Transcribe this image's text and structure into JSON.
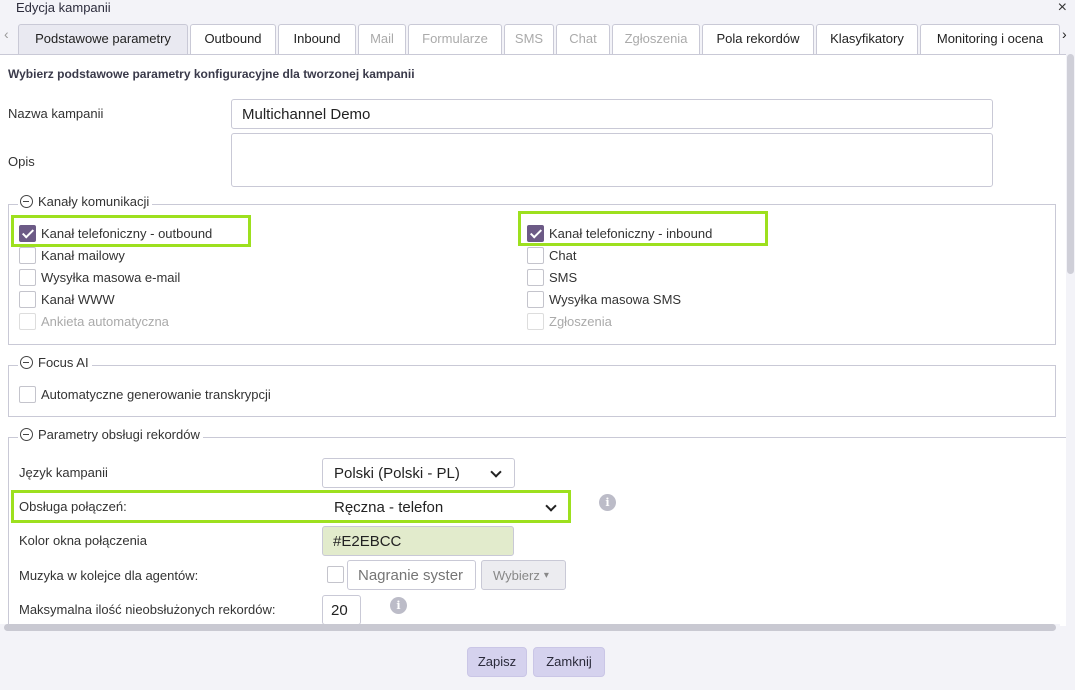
{
  "window": {
    "title": "Edycja kampanii",
    "close_symbol": "×"
  },
  "tabs": [
    {
      "label": "Podstawowe parametry",
      "active": true,
      "disabled": false
    },
    {
      "label": "Outbound",
      "active": false,
      "disabled": false
    },
    {
      "label": "Inbound",
      "active": false,
      "disabled": false
    },
    {
      "label": "Mail",
      "active": false,
      "disabled": true
    },
    {
      "label": "Formularze",
      "active": false,
      "disabled": true
    },
    {
      "label": "SMS",
      "active": false,
      "disabled": true
    },
    {
      "label": "Chat",
      "active": false,
      "disabled": true
    },
    {
      "label": "Zgłoszenia",
      "active": false,
      "disabled": true
    },
    {
      "label": "Pola rekordów",
      "active": false,
      "disabled": false
    },
    {
      "label": "Klasyfikatory",
      "active": false,
      "disabled": false
    },
    {
      "label": "Monitoring i ocena",
      "active": false,
      "disabled": false
    }
  ],
  "tab_nav": {
    "prev_symbol": "‹",
    "next_symbol": "›"
  },
  "intro": "Wybierz podstawowe parametry konfiguracyjne dla tworzonej kampanii",
  "campaign_name": {
    "label": "Nazwa kampanii",
    "value": "Multichannel Demo"
  },
  "description": {
    "label": "Opis",
    "value": ""
  },
  "channels": {
    "legend": "Kanały komunikacji",
    "left": [
      {
        "label": "Kanał telefoniczny - outbound",
        "checked": true,
        "disabled": false,
        "highlighted": true
      },
      {
        "label": "Kanał mailowy",
        "checked": false,
        "disabled": false
      },
      {
        "label": "Wysyłka masowa e-mail",
        "checked": false,
        "disabled": false
      },
      {
        "label": "Kanał WWW",
        "checked": false,
        "disabled": false
      },
      {
        "label": "Ankieta automatyczna",
        "checked": false,
        "disabled": true
      }
    ],
    "right": [
      {
        "label": "Kanał telefoniczny - inbound",
        "checked": true,
        "disabled": false,
        "highlighted": true
      },
      {
        "label": "Chat",
        "checked": false,
        "disabled": false
      },
      {
        "label": "SMS",
        "checked": false,
        "disabled": false
      },
      {
        "label": "Wysyłka masowa SMS",
        "checked": false,
        "disabled": false
      },
      {
        "label": "Zgłoszenia",
        "checked": false,
        "disabled": true
      }
    ]
  },
  "focus_ai": {
    "legend": "Focus AI",
    "option": {
      "label": "Automatyczne generowanie transkrypcji",
      "checked": false
    }
  },
  "records": {
    "legend": "Parametry obsługi rekordów",
    "language": {
      "label": "Język kampanii",
      "value": "Polski (Polski - PL)"
    },
    "call_handling": {
      "label": "Obsługa połączeń:",
      "value": "Ręczna - telefon",
      "highlighted": true
    },
    "window_color": {
      "label": "Kolor okna połączenia",
      "value": "#E2EBCC"
    },
    "queue_music": {
      "label": "Muzyka w kolejce dla agentów:",
      "placeholder": "Nagranie syster",
      "choose_label": "Wybierz",
      "caret": "▾",
      "checked": false
    },
    "max_unhandled": {
      "label": "Maksymalna ilość nieobsłużonych rekordów:",
      "value": "20"
    },
    "info_symbol": "i"
  },
  "footer": {
    "save_label": "Zapisz",
    "close_label": "Zamknij"
  },
  "colors": {
    "highlight": "#9de01e",
    "checkbox_checked": "#6c5a86",
    "button_bg": "#d5d2ee",
    "window_color_swatch": "#E2EBCC"
  }
}
